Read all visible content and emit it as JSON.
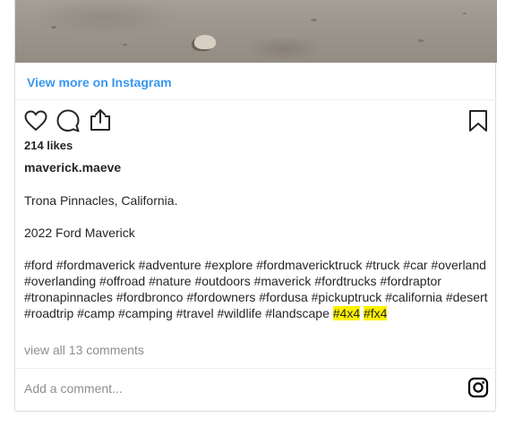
{
  "post": {
    "view_more_label": "View more on Instagram",
    "likes": "214 likes",
    "username": "maverick.maeve",
    "caption_line1": "Trona Pinnacles, California.",
    "caption_line2": "2022 Ford Maverick",
    "hashtags_text": "#ford #fordmaverick #adventure #explore #fordmavericktruck #truck #car #overland #overlanding #offroad #nature #outdoors #maverick #fordtrucks #fordraptor #tronapinnacles #fordbronco #fordowners #fordusa #pickuptruck #california #desert #roadtrip #camp #camping #travel #wildlife #landscape ",
    "highlighted_tag_1": "#4x4",
    "highlighted_tag_2": "#fx4",
    "view_comments_label": "view all 13 comments",
    "comment_placeholder": "Add a comment..."
  },
  "icons": {
    "like": "heart-icon",
    "comment": "comment-icon",
    "share": "share-icon",
    "save": "bookmark-icon",
    "instagram": "instagram-logo-icon"
  },
  "colors": {
    "link": "#3897f0",
    "muted": "#8e8e8e",
    "highlight": "#fff200",
    "text": "#262626"
  }
}
